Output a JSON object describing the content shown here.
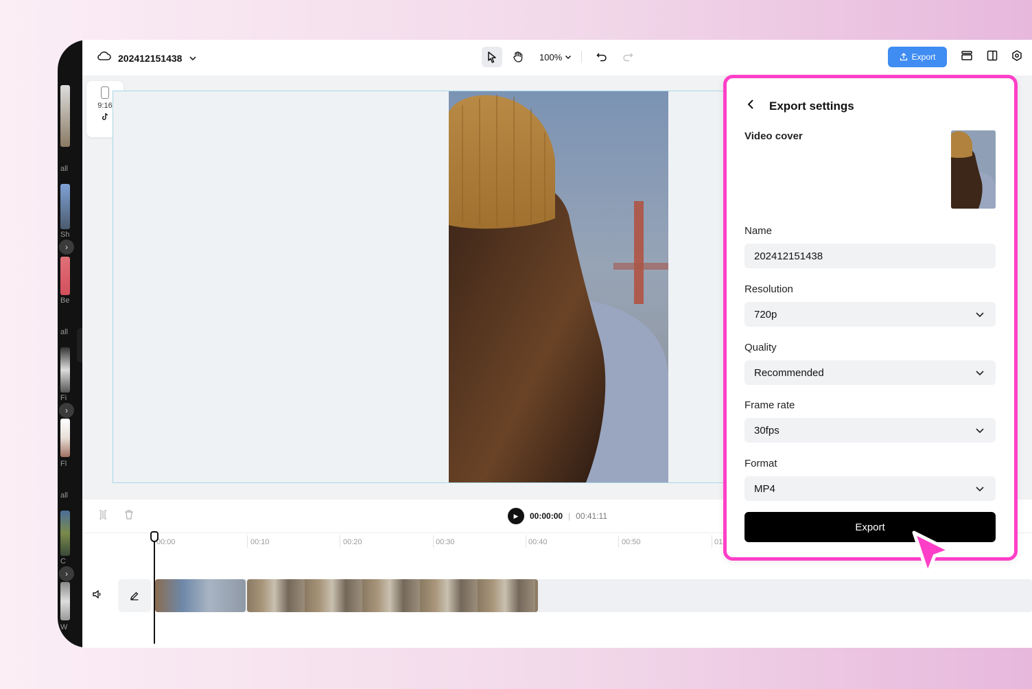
{
  "header": {
    "project_name": "202412151438",
    "zoom": "100%",
    "export_label": "Export"
  },
  "canvas": {
    "ratio_label": "9:16"
  },
  "left_strip": {
    "labels": [
      "all",
      "Sh",
      "Be",
      "all",
      "Fi",
      "Fl",
      "all",
      "C",
      "W"
    ]
  },
  "timeline": {
    "current_time": "00:00:00",
    "total_time": "00:41:11",
    "ticks": [
      "00:00",
      "00:10",
      "00:20",
      "00:30",
      "00:40",
      "00:50",
      "01"
    ]
  },
  "export_panel": {
    "title": "Export settings",
    "video_cover_label": "Video cover",
    "name_label": "Name",
    "name_value": "202412151438",
    "resolution_label": "Resolution",
    "resolution_value": "720p",
    "quality_label": "Quality",
    "quality_value": "Recommended",
    "frame_rate_label": "Frame rate",
    "frame_rate_value": "30fps",
    "format_label": "Format",
    "format_value": "MP4",
    "export_button": "Export"
  },
  "colors": {
    "accent_blue": "#3f8cf2",
    "highlight_pink": "#ff3fc8",
    "export_black": "#000000"
  }
}
